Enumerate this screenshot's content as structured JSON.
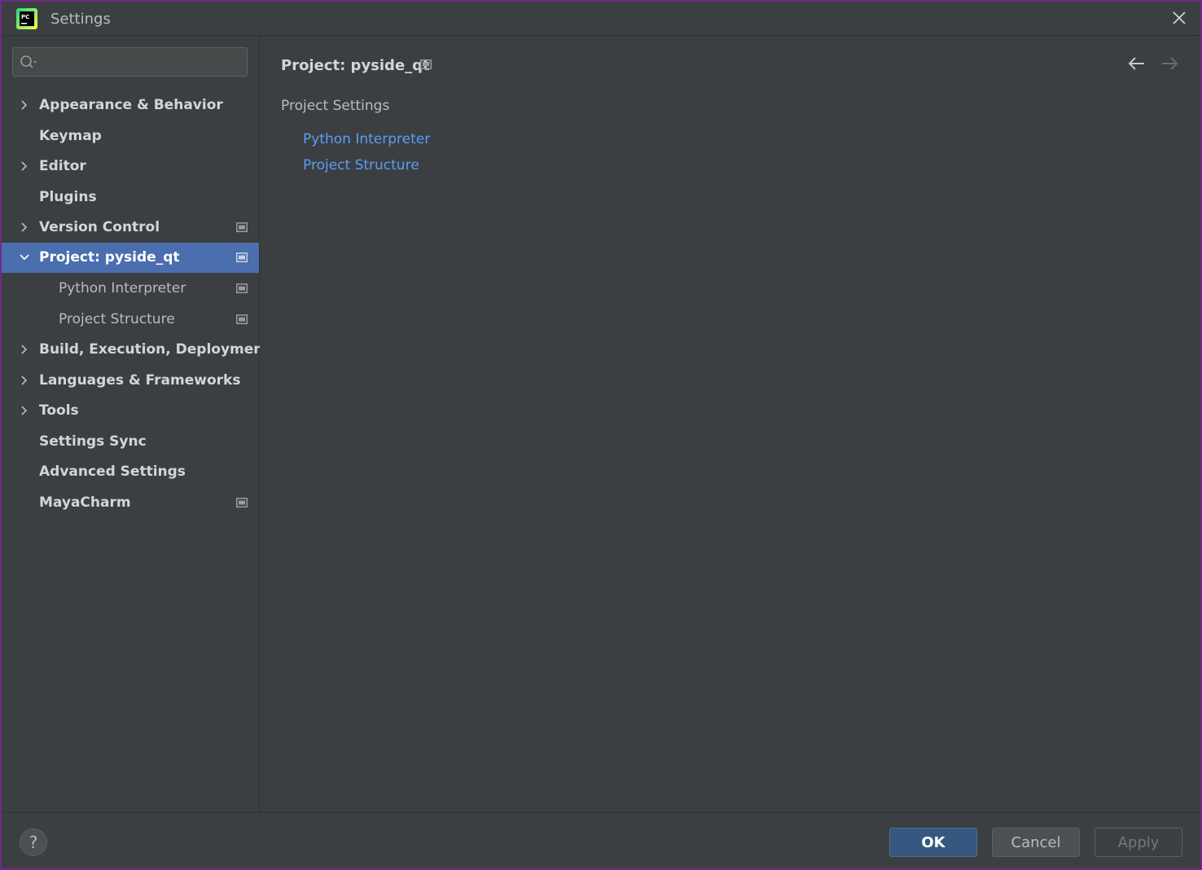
{
  "window": {
    "title": "Settings",
    "app_icon_label": "PC"
  },
  "search": {
    "placeholder": "",
    "value": ""
  },
  "sidebar": {
    "items": [
      {
        "label": "Appearance & Behavior",
        "expandable": true,
        "expanded": false
      },
      {
        "label": "Keymap",
        "expandable": false
      },
      {
        "label": "Editor",
        "expandable": true,
        "expanded": false
      },
      {
        "label": "Plugins",
        "expandable": false
      },
      {
        "label": "Version Control",
        "expandable": true,
        "expanded": false,
        "project_level": true
      },
      {
        "label": "Project: pyside_qt",
        "expandable": true,
        "expanded": true,
        "selected": true,
        "project_level": true
      },
      {
        "label": "Python Interpreter",
        "child": true,
        "project_level": true
      },
      {
        "label": "Project Structure",
        "child": true,
        "project_level": true
      },
      {
        "label": "Build, Execution, Deployment",
        "expandable": true,
        "expanded": false
      },
      {
        "label": "Languages & Frameworks",
        "expandable": true,
        "expanded": false
      },
      {
        "label": "Tools",
        "expandable": true,
        "expanded": false
      },
      {
        "label": "Settings Sync",
        "expandable": false
      },
      {
        "label": "Advanced Settings",
        "expandable": false
      },
      {
        "label": "MayaCharm",
        "expandable": false,
        "project_level": true
      }
    ]
  },
  "content": {
    "breadcrumb": "Project: pyside_qt",
    "section_title": "Project Settings",
    "links": [
      "Python Interpreter",
      "Project Structure"
    ]
  },
  "footer": {
    "help_label": "?",
    "ok_label": "OK",
    "cancel_label": "Cancel",
    "apply_label": "Apply"
  },
  "colors": {
    "background": "#3c3f41",
    "selection": "#4b6eaf",
    "link": "#589df6",
    "border_accent": "#6d2a86",
    "ok_button": "#365880"
  }
}
